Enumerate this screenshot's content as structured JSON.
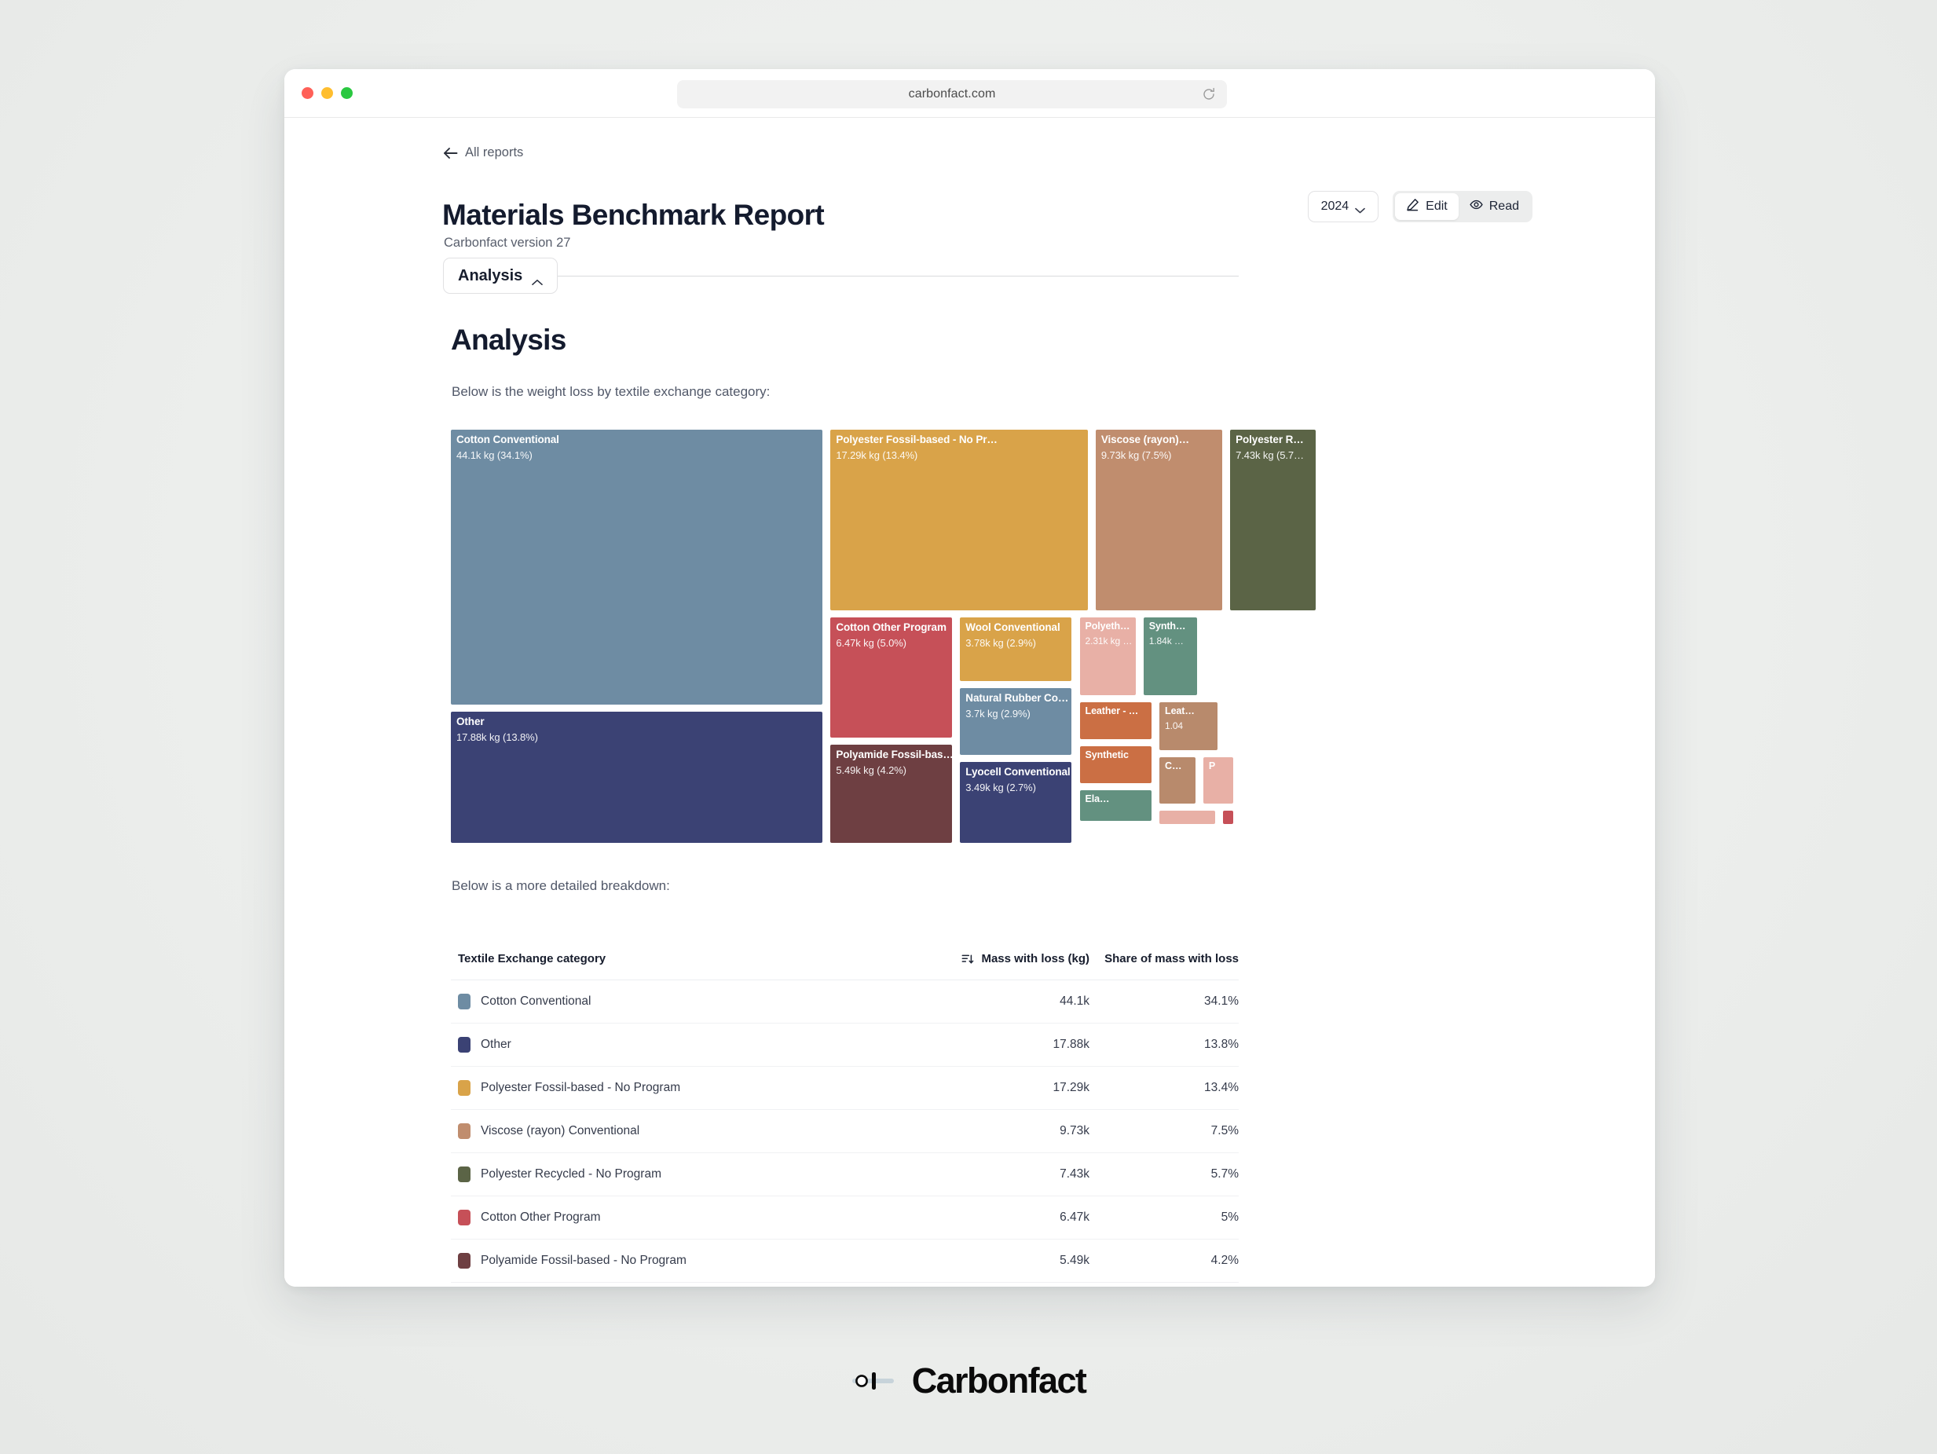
{
  "browser": {
    "url": "carbonfact.com",
    "reload_icon": "reload-icon",
    "traffic_lights": [
      "close",
      "minimize",
      "zoom"
    ]
  },
  "nav": {
    "back_label": "All reports",
    "back_icon": "arrow-left-icon"
  },
  "header": {
    "title": "Materials Benchmark Report",
    "subtitle": "Carbonfact version 27",
    "year_value": "2024",
    "year_chevron_icon": "chevron-down-icon",
    "edit_label": "Edit",
    "edit_icon": "pencil-icon",
    "read_label": "Read",
    "read_icon": "eye-icon"
  },
  "accordion": {
    "tab_label": "Analysis",
    "caret_icon": "chevron-up-icon"
  },
  "section": {
    "heading": "Analysis",
    "intro_text": "Below is the weight loss by textile exchange category:",
    "breakdown_text": "Below is a more detailed breakdown:"
  },
  "chart_data": {
    "type": "treemap",
    "title": "Weight loss by textile exchange category",
    "value_unit": "kg",
    "total_note": "Mass with loss (kg)",
    "legend": "none",
    "nodes": [
      {
        "label": "Cotton Conventional",
        "value_text": "44.1k kg (34.1%)",
        "value": 44100,
        "share": 34.1,
        "color": "#6e8ca3"
      },
      {
        "label": "Other",
        "value_text": "17.88k kg (13.8%)",
        "value": 17880,
        "share": 13.8,
        "color": "#3b4274"
      },
      {
        "label": "Polyester Fossil-based - No Pr…",
        "value_text": "17.29k kg (13.4%)",
        "value": 17290,
        "share": 13.4,
        "color": "#d9a349"
      },
      {
        "label": "Viscose (rayon)…",
        "value_text": "9.73k kg (7.5%)",
        "value": 9730,
        "share": 7.5,
        "color": "#c08d6e"
      },
      {
        "label": "Polyester R…",
        "value_text": "7.43k kg (5.7…",
        "value": 7430,
        "share": 5.7,
        "color": "#5b6446"
      },
      {
        "label": "Cotton Other Program",
        "value_text": "6.47k kg (5.0%)",
        "value": 6470,
        "share": 5.0,
        "color": "#c65058"
      },
      {
        "label": "Polyamide Fossil-bas…",
        "value_text": "5.49k kg (4.2%)",
        "value": 5490,
        "share": 4.2,
        "color": "#6e3f42"
      },
      {
        "label": "Wool Conventional",
        "value_text": "3.78k kg (2.9%)",
        "value": 3780,
        "share": 2.9,
        "color": "#d9a349"
      },
      {
        "label": "Natural Rubber Co…",
        "value_text": "3.7k kg (2.9%)",
        "value": 3700,
        "share": 2.9,
        "color": "#6e8ca3"
      },
      {
        "label": "Lyocell Conventional",
        "value_text": "3.49k kg (2.7%)",
        "value": 3490,
        "share": 2.7,
        "color": "#3b4274"
      },
      {
        "label": "Polyeth…",
        "value_text": "2.31k kg …",
        "value": 2310,
        "share": 1.8,
        "color": "#e8b0a6"
      },
      {
        "label": "Synth…",
        "value_text": "1.84k …",
        "value": 1840,
        "share": 1.4,
        "color": "#639180"
      },
      {
        "label": "Leather - …",
        "value_text": "",
        "value": 1300,
        "share": 1.0,
        "color": "#cb6f44"
      },
      {
        "label": "Leat…",
        "value_text": "1.04",
        "value": 1040,
        "share": 0.8,
        "color": "#b88a6c"
      },
      {
        "label": "Synthetic",
        "value_text": "",
        "value": 980,
        "share": 0.75,
        "color": "#cb6f44"
      },
      {
        "label": "Ela…",
        "value_text": "",
        "value": 820,
        "share": 0.63,
        "color": "#639180"
      },
      {
        "label": "C…",
        "value_text": "",
        "value": 560,
        "share": 0.43,
        "color": "#b88a6c"
      },
      {
        "label": "P",
        "value_text": "",
        "value": 430,
        "share": 0.33,
        "color": "#e8b0a6"
      },
      {
        "label": "",
        "value_text": "",
        "value": 330,
        "share": 0.25,
        "color": "#e8b0a6"
      },
      {
        "label": "",
        "value_text": "",
        "value": 120,
        "share": 0.09,
        "color": "#c65058"
      }
    ]
  },
  "table": {
    "columns": [
      "Textile Exchange category",
      "Mass with loss (kg)",
      "Share of mass with loss"
    ],
    "sort_icon": "sort-descending-icon",
    "sorted_column": "Mass with loss (kg)",
    "rows": [
      {
        "color": "#6e8ca3",
        "category": "Cotton Conventional",
        "mass": "44.1k",
        "share": "34.1%"
      },
      {
        "color": "#3b4274",
        "category": "Other",
        "mass": "17.88k",
        "share": "13.8%"
      },
      {
        "color": "#d9a349",
        "category": "Polyester Fossil-based - No Program",
        "mass": "17.29k",
        "share": "13.4%"
      },
      {
        "color": "#c08d6e",
        "category": "Viscose (rayon) Conventional",
        "mass": "9.73k",
        "share": "7.5%"
      },
      {
        "color": "#5b6446",
        "category": "Polyester Recycled - No Program",
        "mass": "7.43k",
        "share": "5.7%"
      },
      {
        "color": "#c65058",
        "category": "Cotton Other Program",
        "mass": "6.47k",
        "share": "5%"
      },
      {
        "color": "#6e3f42",
        "category": "Polyamide Fossil-based - No Program",
        "mass": "5.49k",
        "share": "4.2%"
      }
    ]
  },
  "footer": {
    "brand": "Carbonfact",
    "logo_icon": "carbonfact-logo-icon"
  }
}
